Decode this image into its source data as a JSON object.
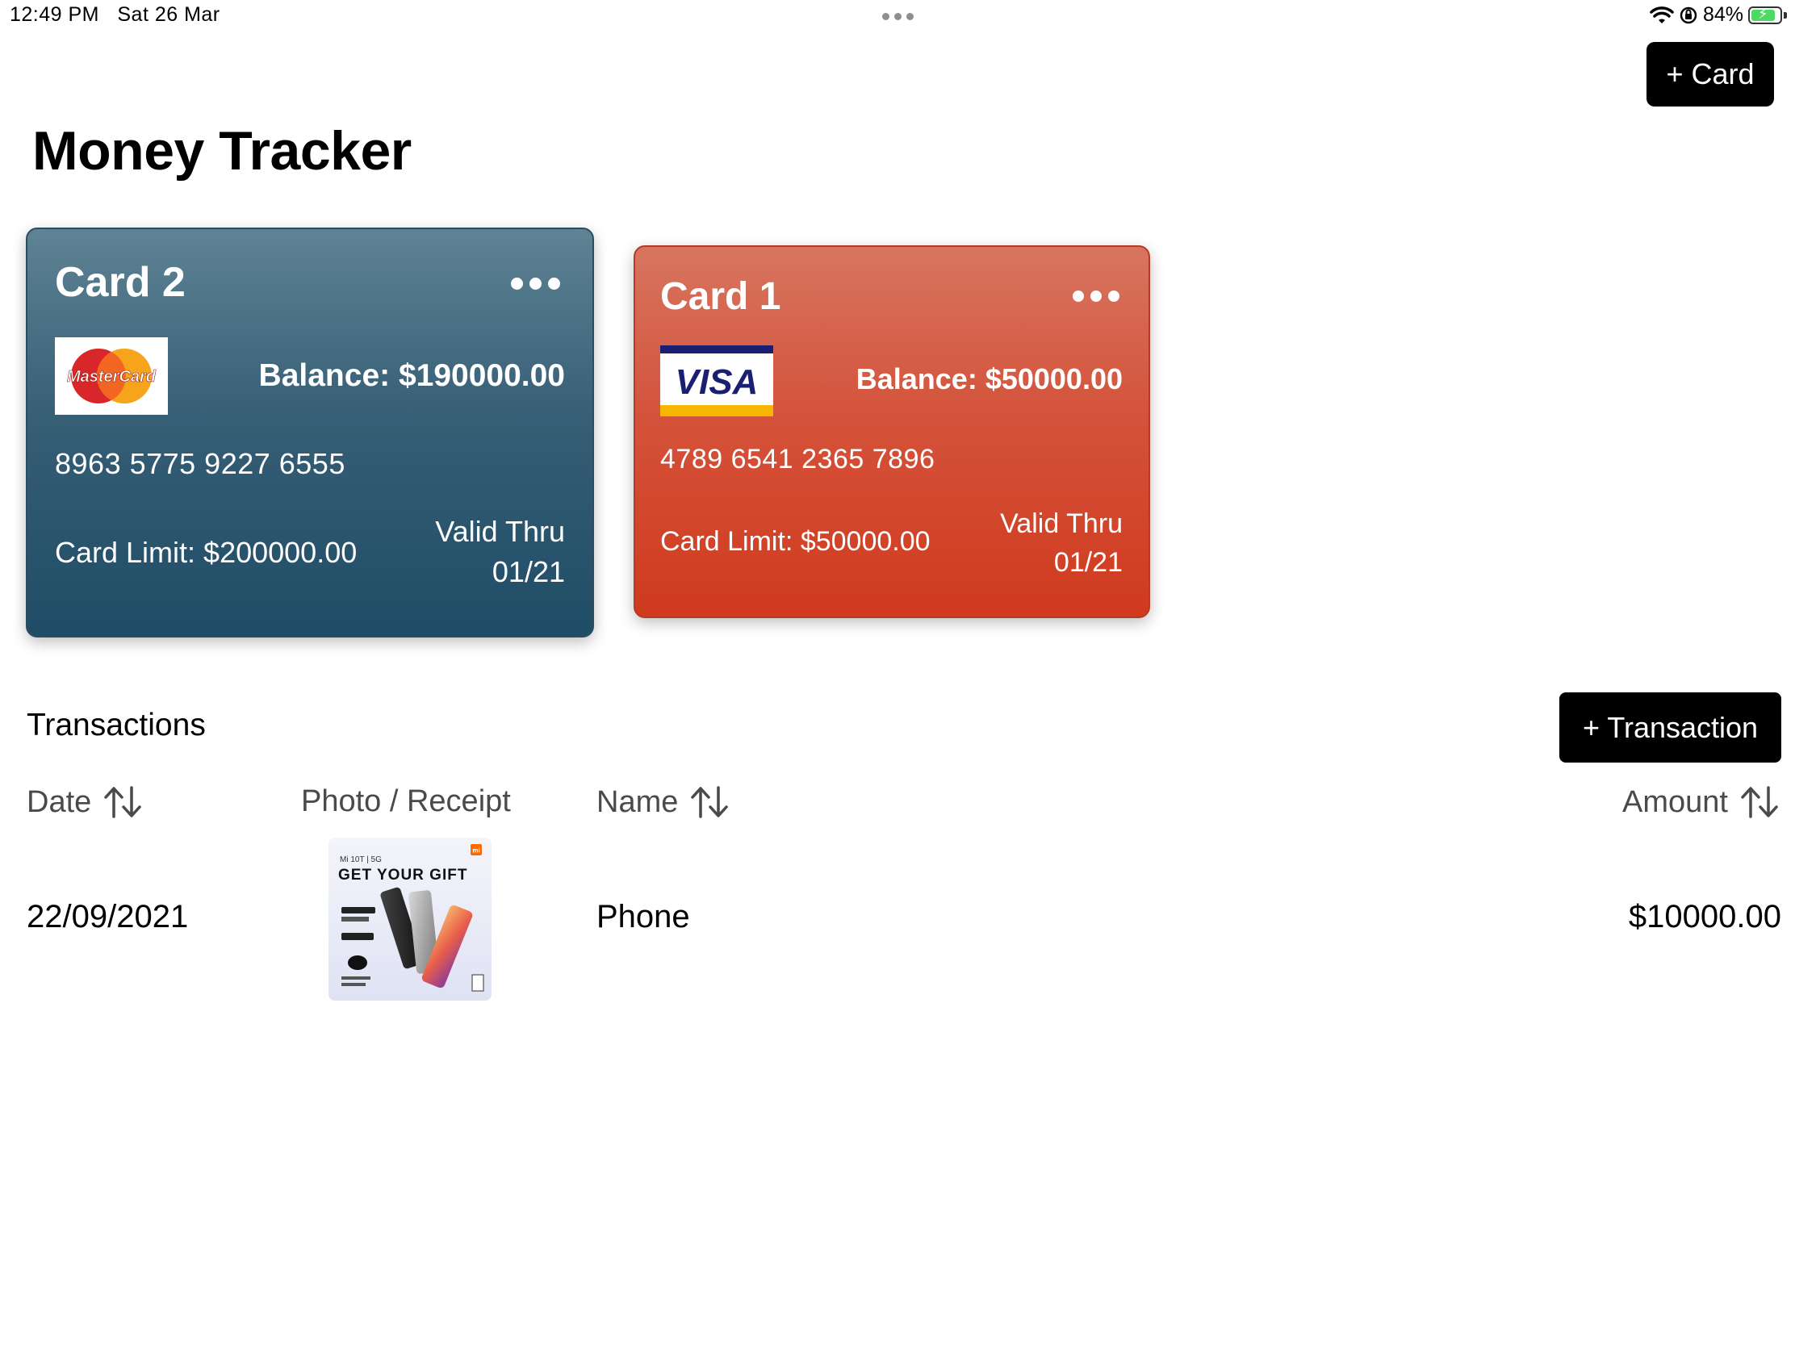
{
  "status_bar": {
    "time": "12:49 PM",
    "date": "Sat 26 Mar",
    "battery_text": "84%",
    "battery_level": 0.84,
    "wifi_icon": "wifi-icon",
    "lock_icon": "orientation-lock-icon"
  },
  "header": {
    "add_card_label": "+ Card",
    "title": "Money Tracker"
  },
  "cards": [
    {
      "name": "Card 2",
      "network": "MasterCard",
      "balance": "Balance: $190000.00",
      "number": "8963 5775 9227 6555",
      "limit": "Card Limit: $200000.00",
      "valid_label": "Valid Thru",
      "valid_date": "01/21",
      "color": "#2b5a72"
    },
    {
      "name": "Card 1",
      "network": "VISA",
      "balance": "Balance: $50000.00",
      "number": "4789 6541 2365 7896",
      "limit": "Card Limit: $50000.00",
      "valid_label": "Valid Thru",
      "valid_date": "01/21",
      "color": "#d3452b"
    }
  ],
  "transactions": {
    "title": "Transactions",
    "add_label": "+ Transaction",
    "columns": {
      "date": "Date",
      "photo": "Photo / Receipt",
      "name": "Name",
      "amount": "Amount"
    },
    "rows": [
      {
        "date": "22/09/2021",
        "receipt_text": {
          "brand": "mi",
          "model": "Mi 10T | 5G",
          "headline": "GET YOUR GIFT"
        },
        "name": "Phone",
        "amount": "$10000.00"
      }
    ]
  }
}
